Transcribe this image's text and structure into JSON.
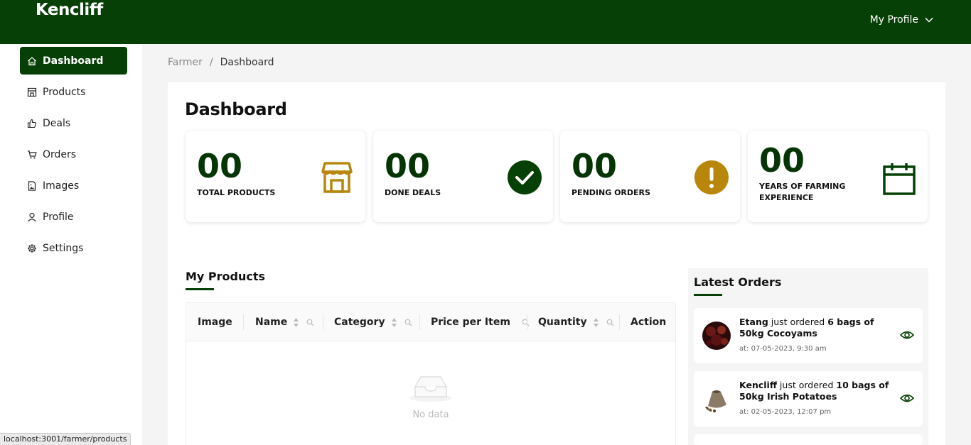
{
  "header": {
    "logo": "Kencliff",
    "profile_label": "My Profile"
  },
  "sidebar": {
    "items": [
      {
        "label": "Dashboard",
        "icon": "home-icon",
        "active": true
      },
      {
        "label": "Products",
        "icon": "store-icon"
      },
      {
        "label": "Deals",
        "icon": "thumbs-up-icon"
      },
      {
        "label": "Orders",
        "icon": "cart-icon"
      },
      {
        "label": "Images",
        "icon": "image-file-icon"
      },
      {
        "label": "Profile",
        "icon": "user-icon"
      },
      {
        "label": "Settings",
        "icon": "gear-icon"
      }
    ]
  },
  "breadcrumb": {
    "parent": "Farmer",
    "separator": "/",
    "current": "Dashboard"
  },
  "page_title": "Dashboard",
  "stats": [
    {
      "value": "00",
      "label": "TOTAL PRODUCTS",
      "icon": "store-icon",
      "color": "#b8860b"
    },
    {
      "value": "00",
      "label": "DONE DEALS",
      "icon": "check-circle-icon",
      "color": "#064006"
    },
    {
      "value": "00",
      "label": "PENDING ORDERS",
      "icon": "exclamation-circle-icon",
      "color": "#b8860b"
    },
    {
      "value": "00",
      "label": "YEARS OF FARMING EXPERIENCE",
      "icon": "calendar-icon",
      "color": "#064006"
    }
  ],
  "products": {
    "title": "My Products",
    "columns": [
      "Image",
      "Name",
      "Category",
      "Price per Item",
      "Quantity",
      "Action"
    ],
    "empty_text": "No data"
  },
  "orders": {
    "title": "Latest Orders",
    "items": [
      {
        "buyer": "Etang",
        "verb": " just ordered ",
        "product": "6 bags of 50kg Cocoyams",
        "time": "at: 07-05-2023, 9:30 am"
      },
      {
        "buyer": "Kencliff",
        "verb": " just ordered ",
        "product": "10 bags of 50kg Irish Potatoes",
        "time": "at: 02-05-2023, 12:07 pm"
      }
    ]
  },
  "status_bar": {
    "url": "localhost:3001/farmer/products"
  },
  "colors": {
    "brand": "#064006",
    "accent": "#b8860b"
  }
}
